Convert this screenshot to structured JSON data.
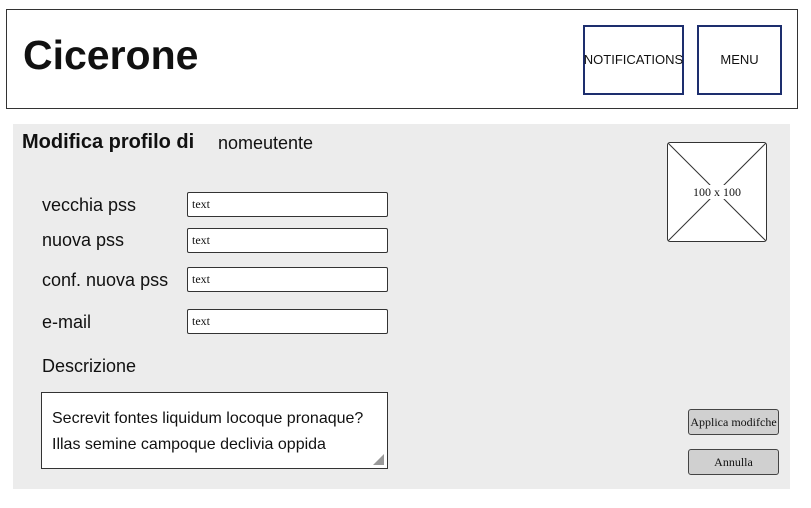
{
  "header": {
    "title": "Cicerone",
    "notifications_label": "NOTIFICATIONS",
    "menu_label": "MENU"
  },
  "profile_form": {
    "heading": "Modifica profilo di",
    "username": "nomeutente",
    "fields": [
      {
        "label": "vecchia pss",
        "placeholder": "text"
      },
      {
        "label": "nuova pss",
        "placeholder": "text"
      },
      {
        "label": "conf. nuova pss",
        "placeholder": "text"
      },
      {
        "label": "e-mail",
        "placeholder": "text"
      }
    ],
    "description_label": "Descrizione",
    "description_lines": [
      "Secrevit fontes liquidum locoque pronaque?",
      "Illas semine campoque declivia oppida"
    ],
    "avatar_placeholder": "100 x 100",
    "apply_label": "Applica modifche",
    "cancel_label": "Annulla"
  }
}
